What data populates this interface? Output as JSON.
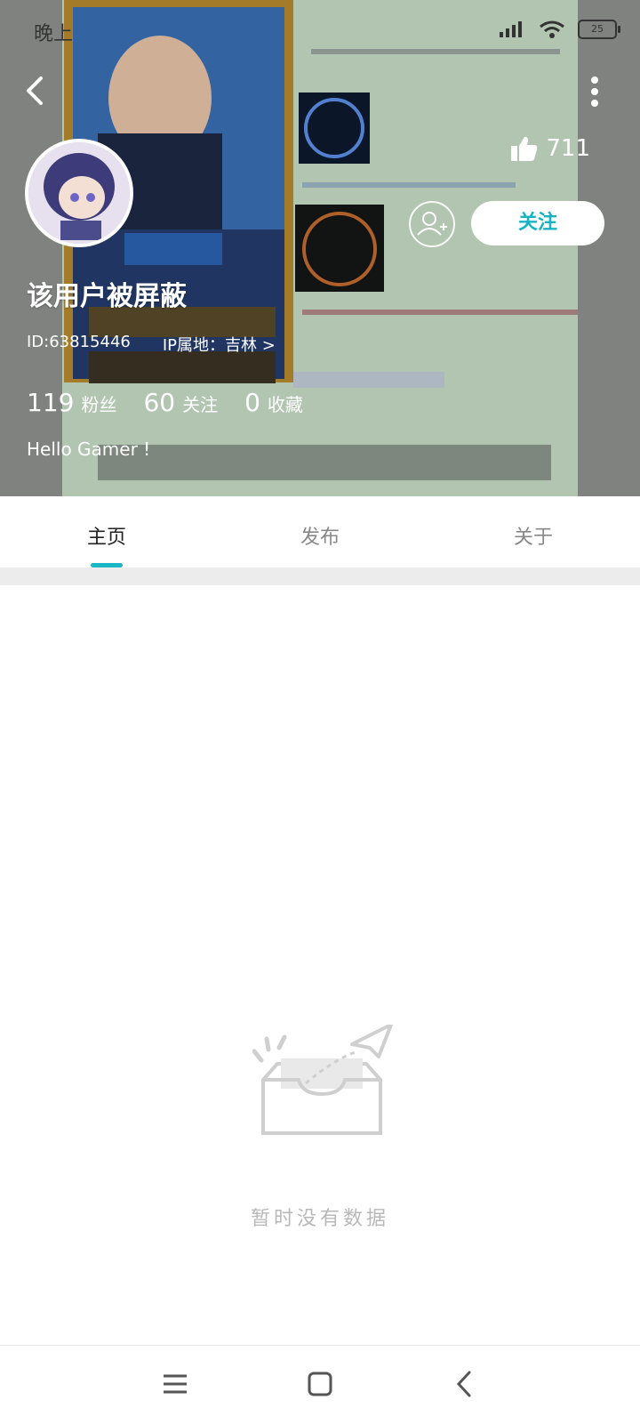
{
  "status_bar": {
    "time": "晚上",
    "battery": "25"
  },
  "profile": {
    "username": "该用户被屏蔽",
    "id_text": "ID:63815446",
    "ip_location": "IP属地：吉林 >",
    "likes": "711",
    "follow_label": "关注",
    "stats": [
      {
        "value": "119",
        "label": "粉丝"
      },
      {
        "value": "60",
        "label": "关注"
      },
      {
        "value": "0",
        "label": "收藏"
      }
    ],
    "bio": "Hello Gamer !"
  },
  "tabs": [
    {
      "label": "主页",
      "active": true
    },
    {
      "label": "发布",
      "active": false
    },
    {
      "label": "关于",
      "active": false
    }
  ],
  "empty_state": {
    "message": "暂时没有数据"
  },
  "colors": {
    "accent": "#19b6c4",
    "follow_text": "#17b3c5"
  },
  "icons": [
    "back-icon",
    "more-icon",
    "thumbs-up-icon",
    "add-friend-icon",
    "menu-icon",
    "home-icon",
    "nav-back-icon"
  ]
}
